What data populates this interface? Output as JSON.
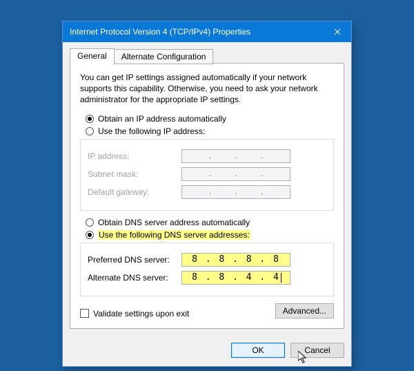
{
  "window": {
    "title": "Internet Protocol Version 4 (TCP/IPv4) Properties"
  },
  "tabs": {
    "general": "General",
    "alternate": "Alternate Configuration"
  },
  "intro": "You can get IP settings assigned automatically if your network supports this capability. Otherwise, you need to ask your network administrator for the appropriate IP settings.",
  "ip": {
    "auto": "Obtain an IP address automatically",
    "manual": "Use the following IP address:",
    "addr_label": "IP address:",
    "mask_label": "Subnet mask:",
    "gw_label": "Default gateway:"
  },
  "dns": {
    "auto": "Obtain DNS server address automatically",
    "manual": "Use the following DNS server addresses:",
    "preferred_label": "Preferred DNS server:",
    "alternate_label": "Alternate DNS server:",
    "preferred_value": "8 . 8 . 8 . 8",
    "alternate_value": "8 . 8 . 4 . 4"
  },
  "validate": "Validate settings upon exit",
  "advanced": "Advanced...",
  "buttons": {
    "ok": "OK",
    "cancel": "Cancel"
  }
}
